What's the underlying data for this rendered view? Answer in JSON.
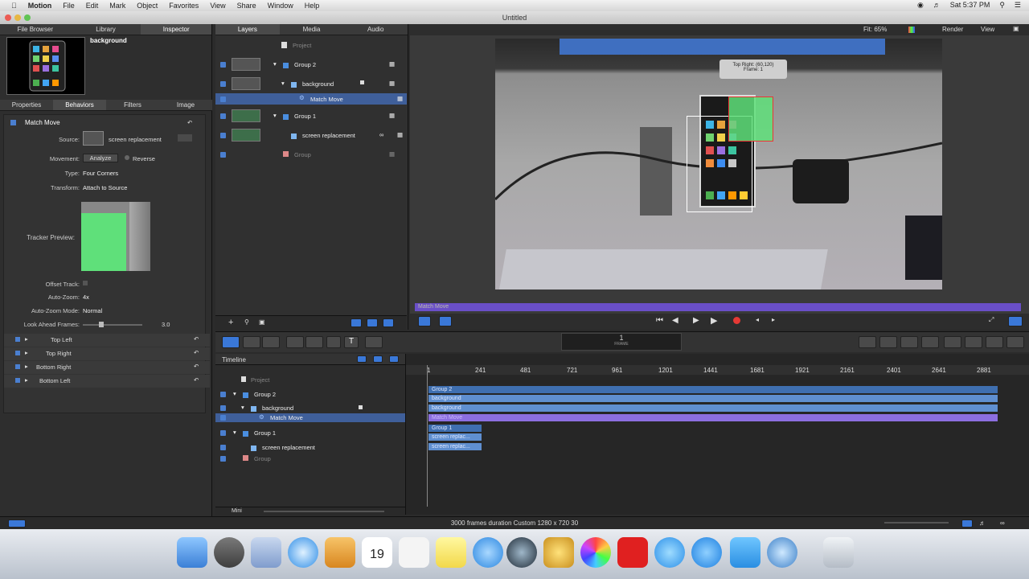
{
  "menubar": {
    "apple": "",
    "app": "Motion",
    "items": [
      "File",
      "Edit",
      "Mark",
      "Object",
      "Favorites",
      "View",
      "Share",
      "Window",
      "Help"
    ],
    "clock": "Sat 5:37 PM"
  },
  "window": {
    "title": "Untitled"
  },
  "left_tabs": [
    "File Browser",
    "Library",
    "Inspector"
  ],
  "inspector": {
    "object_name": "background",
    "sub_tabs": [
      "Properties",
      "Behaviors",
      "Filters",
      "Image"
    ],
    "behavior_title": "Match Move",
    "source_label": "Source:",
    "source_value": "screen replacement",
    "movement_label": "Movement:",
    "analyze_label": "Analyze",
    "reverse_label": "Reverse",
    "type_label": "Type:",
    "type_value": "Four Corners",
    "transform_label": "Transform:",
    "transform_value": "Attach to Source",
    "tracker_preview_label": "Tracker Preview:",
    "offset_track_label": "Offset Track:",
    "auto_zoom_label": "Auto-Zoom:",
    "auto_zoom_value": "4x",
    "auto_zoom_mode_label": "Auto-Zoom Mode:",
    "auto_zoom_mode_value": "Normal",
    "look_ahead_label": "Look Ahead Frames:",
    "look_ahead_value": "3.0",
    "corners": [
      "Top Left",
      "Top Right",
      "Bottom Right",
      "Bottom Left"
    ]
  },
  "layers_tabs": [
    "Layers",
    "Media",
    "Audio"
  ],
  "layers": [
    {
      "name": "Project",
      "indent": 0
    },
    {
      "name": "Group 2",
      "indent": 1
    },
    {
      "name": "background",
      "indent": 2
    },
    {
      "name": "Match Move",
      "indent": 3
    },
    {
      "name": "Group 1",
      "indent": 1
    },
    {
      "name": "screen replacement",
      "indent": 2
    },
    {
      "name": "Group",
      "indent": 1
    }
  ],
  "canvas": {
    "fit": "Fit: 65%",
    "render": "Render",
    "view": "View",
    "tooltip_line1": "Top Right: (60,120)",
    "tooltip_line2": "Frame: 1",
    "mini_bar_label": "Match Move"
  },
  "toolbar": {
    "frame_value": "1",
    "frame_label": "FRAME"
  },
  "timeline": {
    "title": "Timeline",
    "ruler": [
      "1",
      "241",
      "481",
      "721",
      "961",
      "1201",
      "1441",
      "1681",
      "1921",
      "2161",
      "2401",
      "2641",
      "2881"
    ],
    "rows": [
      "Project",
      "Group 2",
      "background",
      "Match Move",
      "Group 1",
      "screen replacement",
      "Group"
    ],
    "tracks": [
      "Group 2",
      "background",
      "background",
      "Match Move",
      "Group 1",
      "screen replac...",
      "screen replac..."
    ],
    "mini_label": "Mini"
  },
  "status": {
    "text": "3000 frames duration Custom 1280 x 720 30"
  },
  "colors": {
    "accent": "#4a7fd0",
    "behavior_track": "#8c6fe0",
    "group_track": "#3f6fb0"
  }
}
